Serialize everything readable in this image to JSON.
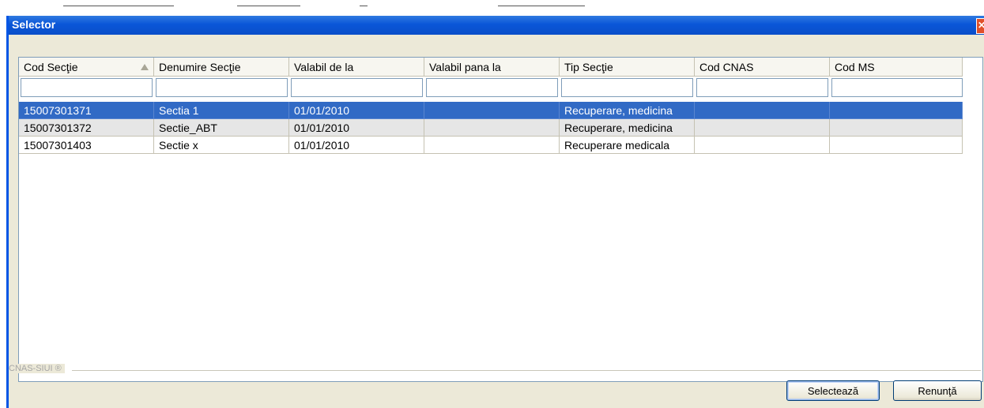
{
  "window": {
    "title": "Selector",
    "close_glyph": "✕"
  },
  "grid": {
    "columns": [
      {
        "label": "Cod Secţie",
        "sorted": "ascending"
      },
      {
        "label": "Denumire Secţie"
      },
      {
        "label": "Valabil de la"
      },
      {
        "label": "Valabil pana la"
      },
      {
        "label": "Tip Secţie"
      },
      {
        "label": "Cod CNAS"
      },
      {
        "label": "Cod MS"
      }
    ],
    "filters": [
      "",
      "",
      "",
      "",
      "",
      "",
      ""
    ],
    "rows": [
      {
        "cells": [
          "15007301371",
          "Sectia 1",
          "01/01/2010",
          "",
          "Recuperare, medicina",
          "",
          ""
        ],
        "state": "selected"
      },
      {
        "cells": [
          "15007301372",
          "Sectie_ABT",
          "01/01/2010",
          "",
          "Recuperare, medicina",
          "",
          ""
        ],
        "state": "alt"
      },
      {
        "cells": [
          "15007301403",
          "Sectie x",
          "01/01/2010",
          "",
          "Recuperare medicala",
          "",
          ""
        ],
        "state": "plain"
      }
    ]
  },
  "footer": {
    "group_label": "CNAS-SIUI ®",
    "select_label": "Selectează",
    "cancel_label": "Renunţă"
  },
  "colors": {
    "titlebar": "#0a56d8",
    "selection": "#316ac5",
    "dialog_bg": "#ece9d8"
  }
}
